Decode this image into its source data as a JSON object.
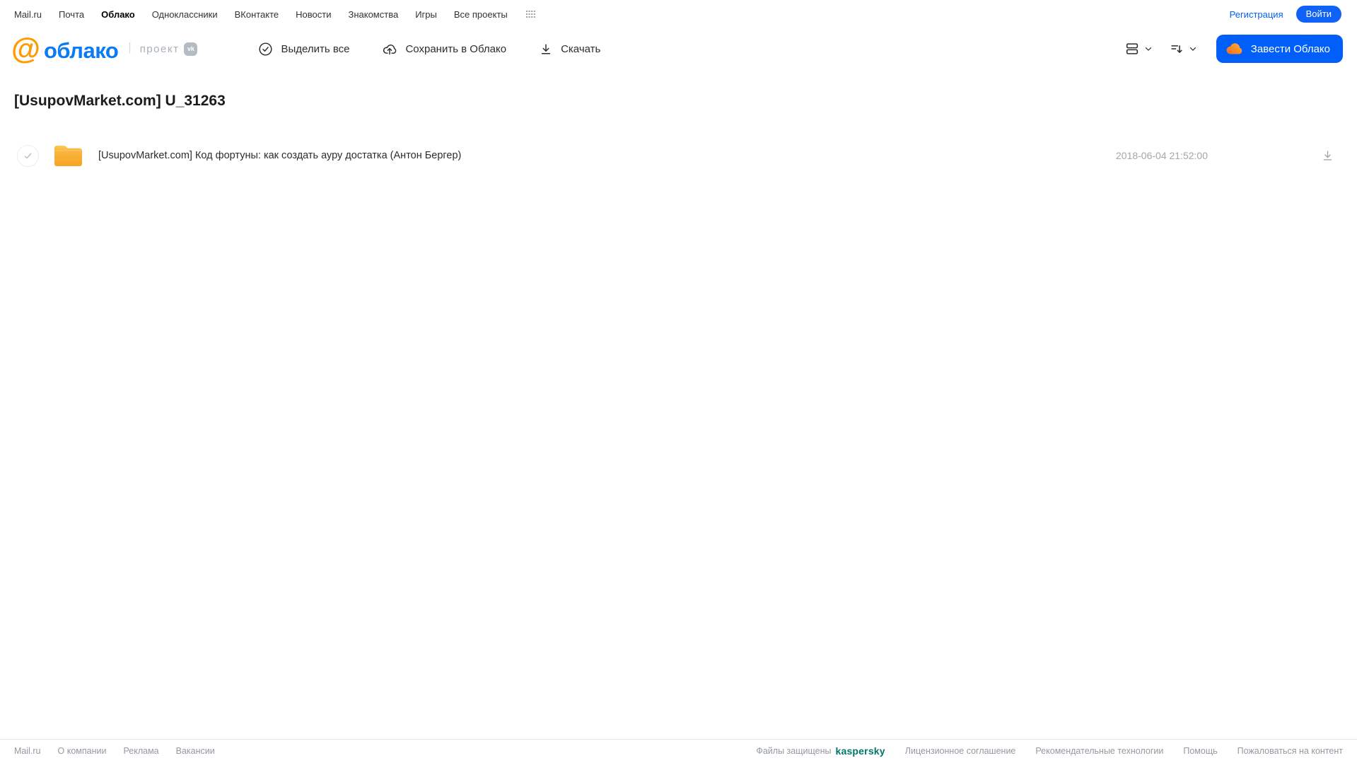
{
  "topnav": {
    "links": [
      "Mail.ru",
      "Почта",
      "Облако",
      "Одноклассники",
      "ВКонтакте",
      "Новости",
      "Знакомства",
      "Игры",
      "Все проекты"
    ],
    "active_link": "Облако",
    "registration_label": "Регистрация",
    "login_label": "Войти"
  },
  "header": {
    "logo_at": "@",
    "logo_word": "облако",
    "project_label": "проект",
    "vk_badge": "vk",
    "toolbar": {
      "select_all": "Выделить все",
      "save_to_cloud": "Сохранить в Облако",
      "download": "Скачать"
    },
    "create_cloud_label": "Завести Облако"
  },
  "page": {
    "title": "[UsupovMarket.com] U_31263"
  },
  "files": [
    {
      "type": "folder",
      "name": "[UsupovMarket.com] Код фортуны: как создать ауру достатка (Антон Бергер)",
      "date": "2018-06-04 21:52:00"
    }
  ],
  "footer": {
    "left_links": [
      "Mail.ru",
      "О компании",
      "Реклама",
      "Вакансии"
    ],
    "protected_text": "Файлы защищены",
    "kaspersky_brand": "kaspersky",
    "right_links": [
      "Лицензионное соглашение",
      "Рекомендательные технологии",
      "Помощь",
      "Пожаловаться на контент"
    ]
  },
  "colors": {
    "accent_blue": "#005ff9",
    "logo_blue": "#0c7bf3",
    "logo_orange": "#ff9a00",
    "folder_yellow_top": "#ffc75a",
    "folder_yellow": "#f8ad2d",
    "kaspersky_teal": "#00766a",
    "footer_gray": "#9399a0"
  }
}
